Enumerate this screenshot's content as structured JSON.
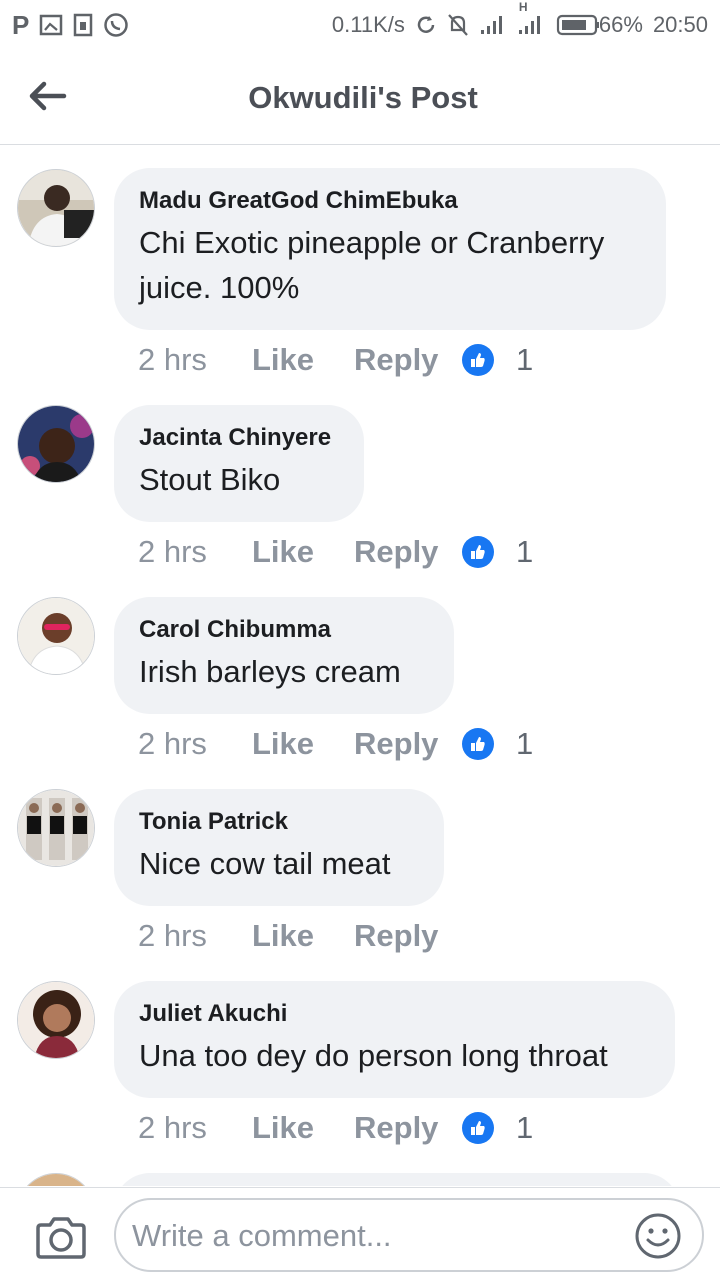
{
  "status_bar": {
    "left_icons": [
      "p-icon",
      "gallery-icon",
      "sim-icon",
      "whatsapp-icon"
    ],
    "p_label": "P",
    "network_speed": "0.11K/s",
    "battery_percent": "66%",
    "time": "20:50",
    "network_label": "H"
  },
  "header": {
    "title": "Okwudili's Post"
  },
  "comments": [
    {
      "author": "Madu GreatGod ChimEbuka",
      "text_line1": "Chi Exotic pineapple or Cranberry",
      "text_line2": "juice. 100%",
      "time": "2 hrs",
      "like_label": "Like",
      "reply_label": "Reply",
      "reaction_count": "1"
    },
    {
      "author": "Jacinta Chinyere",
      "text_line1": "Stout Biko",
      "time": "2 hrs",
      "like_label": "Like",
      "reply_label": "Reply",
      "reaction_count": "1"
    },
    {
      "author": "Carol Chibumma",
      "text_line1": "Irish barleys cream",
      "time": "2 hrs",
      "like_label": "Like",
      "reply_label": "Reply",
      "reaction_count": "1"
    },
    {
      "author": "Tonia Patrick",
      "text_line1": "Nice cow tail meat",
      "time": "2 hrs",
      "like_label": "Like",
      "reply_label": "Reply"
    },
    {
      "author": "Juliet Akuchi",
      "text_line1": "Una too dey do person long throat",
      "time": "2 hrs",
      "like_label": "Like",
      "reply_label": "Reply",
      "reaction_count": "1"
    }
  ],
  "composer": {
    "placeholder": "Write a comment..."
  },
  "colors": {
    "accent": "#1877f2",
    "bubble": "#f0f2f5",
    "meta_text": "#8d949e"
  }
}
